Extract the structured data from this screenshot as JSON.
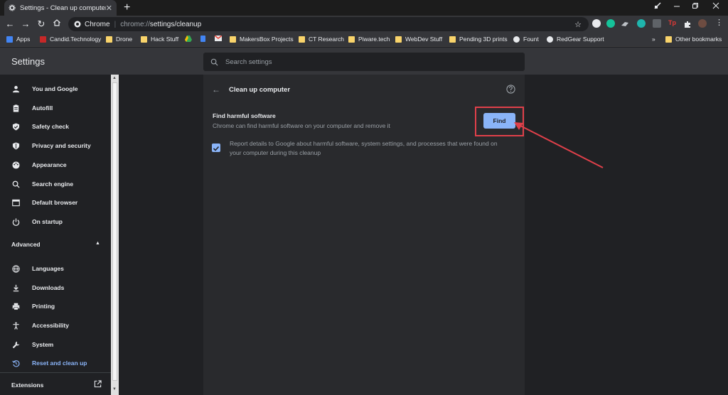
{
  "browser": {
    "tab_title": "Settings - Clean up computer",
    "tab_close": "✕",
    "new_tab": "+",
    "omnibox": {
      "site_label": "Chrome",
      "url_scheme": "chrome://",
      "url_path": "settings/cleanup"
    }
  },
  "bookmarks": [
    {
      "label": "Apps",
      "icon": "apps-icon"
    },
    {
      "label": "Candid.Technology",
      "icon": "site-icon"
    },
    {
      "label": "Drone",
      "icon": "folder-icon"
    },
    {
      "label": "Hack Stuff",
      "icon": "folder-icon"
    },
    {
      "label": "",
      "icon": "drive-icon"
    },
    {
      "label": "",
      "icon": "docs-icon"
    },
    {
      "label": "",
      "icon": "gmail-icon"
    },
    {
      "label": "MakersBox Projects",
      "icon": "folder-icon"
    },
    {
      "label": "CT Research",
      "icon": "folder-icon"
    },
    {
      "label": "Piware.tech",
      "icon": "folder-icon"
    },
    {
      "label": "WebDev Stuff",
      "icon": "folder-icon"
    },
    {
      "label": "Pending 3D prints",
      "icon": "folder-icon"
    },
    {
      "label": "Fount",
      "icon": "globe-icon"
    },
    {
      "label": "RedGear Support",
      "icon": "globe-icon"
    }
  ],
  "bookmarks_more": "»",
  "other_bookmarks": "Other bookmarks",
  "settings": {
    "title": "Settings",
    "search_placeholder": "Search settings"
  },
  "sidebar": {
    "items": [
      {
        "label": "You and Google",
        "icon": "person-icon"
      },
      {
        "label": "Autofill",
        "icon": "clipboard-icon"
      },
      {
        "label": "Safety check",
        "icon": "shield-check-icon"
      },
      {
        "label": "Privacy and security",
        "icon": "shield-icon"
      },
      {
        "label": "Appearance",
        "icon": "palette-icon"
      },
      {
        "label": "Search engine",
        "icon": "search-icon"
      },
      {
        "label": "Default browser",
        "icon": "browser-icon"
      },
      {
        "label": "On startup",
        "icon": "power-icon"
      }
    ],
    "advanced_label": "Advanced",
    "advanced_items": [
      {
        "label": "Languages",
        "icon": "globe-icon"
      },
      {
        "label": "Downloads",
        "icon": "download-icon"
      },
      {
        "label": "Printing",
        "icon": "printer-icon"
      },
      {
        "label": "Accessibility",
        "icon": "accessibility-icon"
      },
      {
        "label": "System",
        "icon": "wrench-icon"
      },
      {
        "label": "Reset and clean up",
        "icon": "restore-icon",
        "active": true
      }
    ],
    "extensions_label": "Extensions"
  },
  "cleanup": {
    "title": "Clean up computer",
    "find_title": "Find harmful software",
    "find_description": "Chrome can find harmful software on your computer and remove it",
    "find_button": "Find",
    "report_checked": true,
    "report_text": "Report details to Google about harmful software, system settings, and processes that were found on your computer during this cleanup"
  },
  "colors": {
    "accent": "#8ab4f8",
    "highlight": "#e0404a",
    "background": "#202124",
    "card": "#292a2d"
  }
}
